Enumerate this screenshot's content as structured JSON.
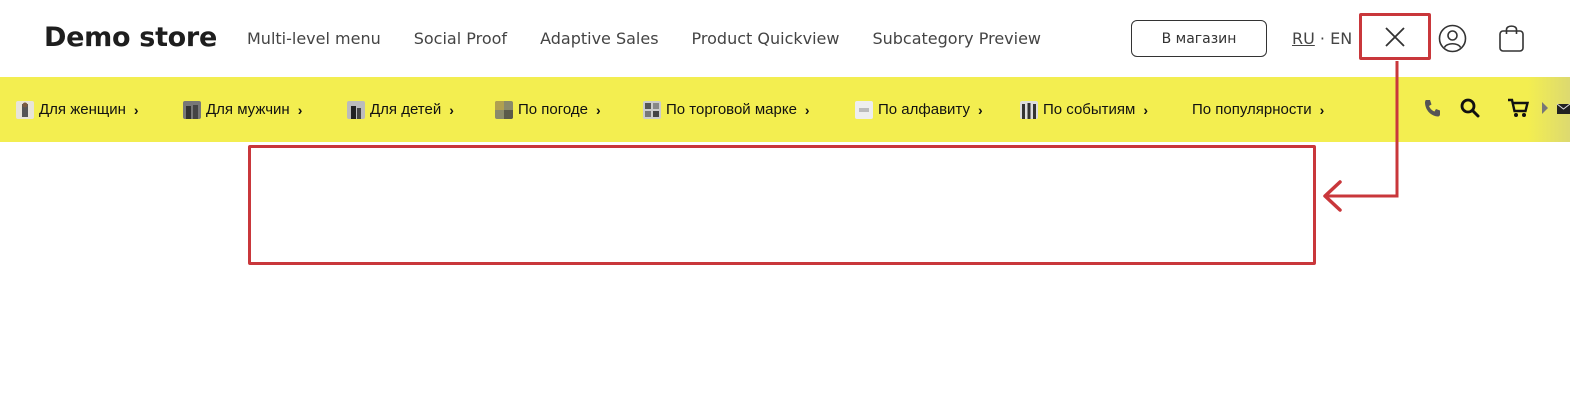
{
  "header": {
    "logo": "Demo store",
    "nav": [
      "Multi-level menu",
      "Social Proof",
      "Adaptive Sales",
      "Product Quickview",
      "Subcategory Preview"
    ],
    "store_button": "В магазин",
    "lang_ru": "RU",
    "lang_separator": "·",
    "lang_en": "EN",
    "icons": [
      "close-icon",
      "user-icon",
      "bag-icon"
    ]
  },
  "catbar": {
    "items": [
      {
        "label": "Для женщин",
        "icon": "women-thumb"
      },
      {
        "label": "Для мужчин",
        "icon": "men-thumb"
      },
      {
        "label": "Для детей",
        "icon": "kids-thumb"
      },
      {
        "label": "По погоде",
        "icon": "weather-thumb"
      },
      {
        "label": "По торговой марке",
        "icon": "brand-thumb"
      },
      {
        "label": "По алфавиту",
        "icon": "alphabet-thumb"
      },
      {
        "label": "По событиям",
        "icon": "events-thumb"
      },
      {
        "label": "По популярности",
        "icon": ""
      }
    ],
    "chevron": "›",
    "right_icons": [
      "phone-icon",
      "search-icon",
      "cart-icon",
      "scroll-right-icon",
      "mail-icon"
    ]
  },
  "colors": {
    "catbar_bg": "#f3ee50",
    "annotation": "#c9373b"
  }
}
